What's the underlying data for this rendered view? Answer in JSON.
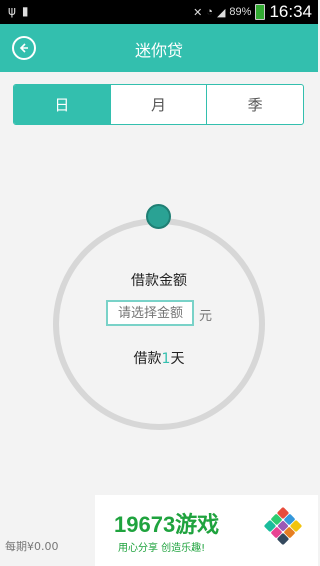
{
  "status_bar": {
    "left_icons": [
      "usb-icon",
      "sim-icon"
    ],
    "right_icons": [
      "no-sound-icon",
      "wifi-icon",
      "signal-icon"
    ],
    "battery_percent": "89%",
    "time": "16:34"
  },
  "header": {
    "title": "迷你贷",
    "back_icon": "back-arrow-icon",
    "color": "#33bfae"
  },
  "tabs": [
    {
      "label": "日",
      "active": true
    },
    {
      "label": "月",
      "active": false
    },
    {
      "label": "季",
      "active": false
    }
  ],
  "loan": {
    "amount_label": "借款金额",
    "amount_placeholder": "请选择金额",
    "amount_unit": "元",
    "term_prefix": "借款",
    "term_value": "1",
    "term_suffix": "天"
  },
  "footer": {
    "left_text": "每期¥0.00"
  },
  "watermark": {
    "title": "19673游戏",
    "subtitle": "用心分享  创造乐趣!"
  }
}
